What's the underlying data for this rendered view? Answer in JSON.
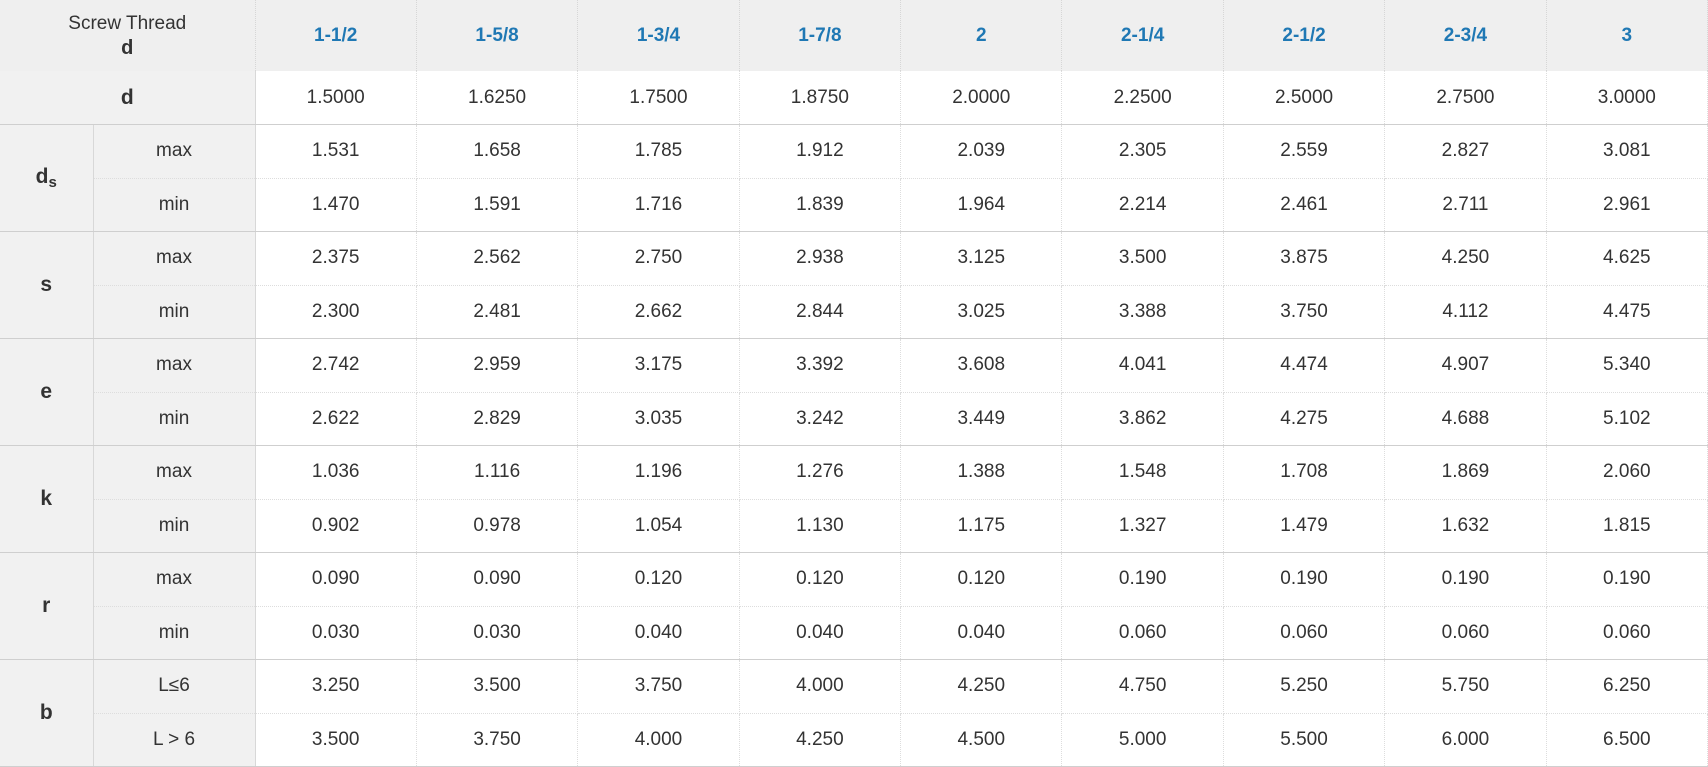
{
  "header": {
    "corner_caption": "Screw Thread",
    "corner_symbol": "d",
    "sizes": [
      "1-1/2",
      "1-5/8",
      "1-3/4",
      "1-7/8",
      "2",
      "2-1/4",
      "2-1/2",
      "2-3/4",
      "3"
    ],
    "accent_color": "#1f78b4"
  },
  "d_row": {
    "label": "d",
    "values": [
      "1.5000",
      "1.6250",
      "1.7500",
      "1.8750",
      "2.0000",
      "2.2500",
      "2.5000",
      "2.7500",
      "3.0000"
    ]
  },
  "groups": [
    {
      "label": "d",
      "sub_label": "s",
      "rows": [
        {
          "sub": "max",
          "values": [
            "1.531",
            "1.658",
            "1.785",
            "1.912",
            "2.039",
            "2.305",
            "2.559",
            "2.827",
            "3.081"
          ]
        },
        {
          "sub": "min",
          "values": [
            "1.470",
            "1.591",
            "1.716",
            "1.839",
            "1.964",
            "2.214",
            "2.461",
            "2.711",
            "2.961"
          ]
        }
      ]
    },
    {
      "label": "s",
      "rows": [
        {
          "sub": "max",
          "values": [
            "2.375",
            "2.562",
            "2.750",
            "2.938",
            "3.125",
            "3.500",
            "3.875",
            "4.250",
            "4.625"
          ]
        },
        {
          "sub": "min",
          "values": [
            "2.300",
            "2.481",
            "2.662",
            "2.844",
            "3.025",
            "3.388",
            "3.750",
            "4.112",
            "4.475"
          ]
        }
      ]
    },
    {
      "label": "e",
      "rows": [
        {
          "sub": "max",
          "values": [
            "2.742",
            "2.959",
            "3.175",
            "3.392",
            "3.608",
            "4.041",
            "4.474",
            "4.907",
            "5.340"
          ]
        },
        {
          "sub": "min",
          "values": [
            "2.622",
            "2.829",
            "3.035",
            "3.242",
            "3.449",
            "3.862",
            "4.275",
            "4.688",
            "5.102"
          ]
        }
      ]
    },
    {
      "label": "k",
      "rows": [
        {
          "sub": "max",
          "values": [
            "1.036",
            "1.116",
            "1.196",
            "1.276",
            "1.388",
            "1.548",
            "1.708",
            "1.869",
            "2.060"
          ]
        },
        {
          "sub": "min",
          "values": [
            "0.902",
            "0.978",
            "1.054",
            "1.130",
            "1.175",
            "1.327",
            "1.479",
            "1.632",
            "1.815"
          ]
        }
      ]
    },
    {
      "label": "r",
      "rows": [
        {
          "sub": "max",
          "values": [
            "0.090",
            "0.090",
            "0.120",
            "0.120",
            "0.120",
            "0.190",
            "0.190",
            "0.190",
            "0.190"
          ]
        },
        {
          "sub": "min",
          "values": [
            "0.030",
            "0.030",
            "0.040",
            "0.040",
            "0.040",
            "0.060",
            "0.060",
            "0.060",
            "0.060"
          ]
        }
      ]
    },
    {
      "label": "b",
      "rows": [
        {
          "sub": "L≤6",
          "values": [
            "3.250",
            "3.500",
            "3.750",
            "4.000",
            "4.250",
            "4.750",
            "5.250",
            "5.750",
            "6.250"
          ]
        },
        {
          "sub": "L > 6",
          "values": [
            "3.500",
            "3.750",
            "4.000",
            "4.250",
            "4.500",
            "5.000",
            "5.500",
            "6.000",
            "6.500"
          ]
        }
      ]
    }
  ]
}
